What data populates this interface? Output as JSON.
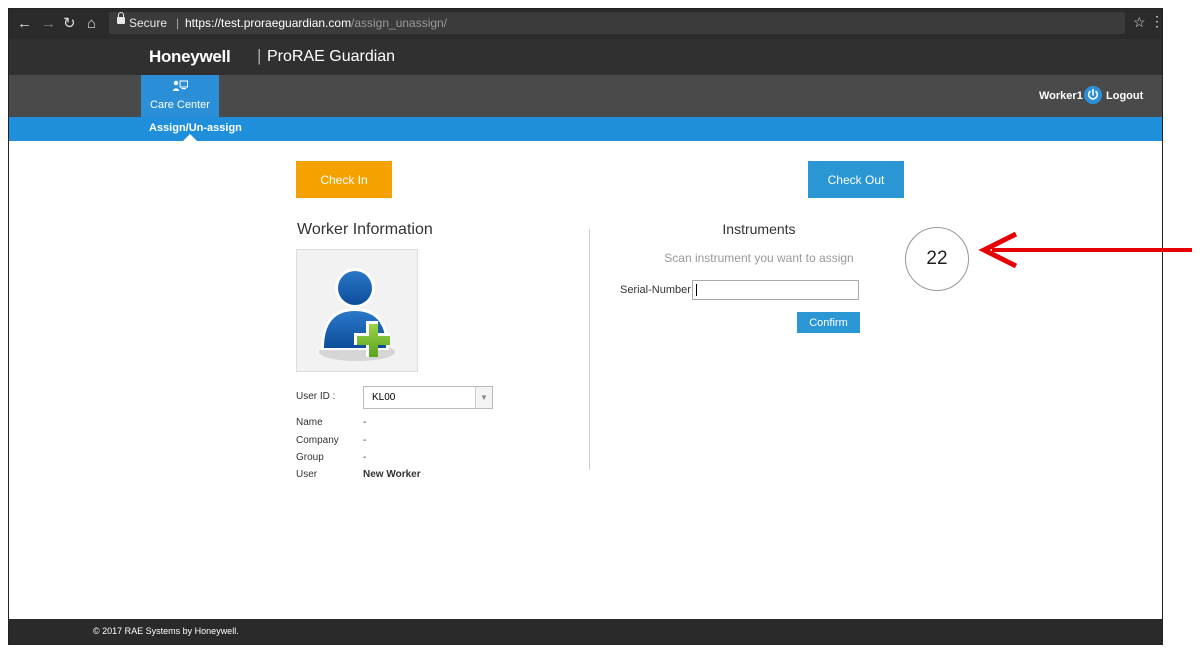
{
  "browser": {
    "secure_label": "Secure",
    "separator": "|",
    "url_host": "https://test.proraeguardian.com",
    "url_path": "/assign_unassign/"
  },
  "header": {
    "brand": "Honeywell",
    "brand_separator": "|",
    "product": "ProRAE Guardian"
  },
  "nav": {
    "care_center_label": "Care Center",
    "user": "Worker1",
    "logout_label": "Logout",
    "subnav_item": "Assign/Un-assign"
  },
  "actions": {
    "check_in_label": "Check In",
    "check_out_label": "Check Out"
  },
  "worker": {
    "title": "Worker Information",
    "user_id_label": "User ID :",
    "user_id_value": "KL00",
    "name_label": "Name",
    "name_value": "-",
    "company_label": "Company",
    "company_value": "-",
    "group_label": "Group",
    "group_value": "-",
    "user_label": "User",
    "user_value": "New Worker"
  },
  "instruments": {
    "title": "Instruments",
    "subtitle": "Scan instrument you want to assign",
    "serial_label": "Serial-Number :",
    "serial_value": "",
    "confirm_label": "Confirm"
  },
  "annotation": {
    "number": "22",
    "arrow_color": "#e60000"
  },
  "footer": {
    "copyright": "© 2017 RAE Systems by Honeywell."
  },
  "colors": {
    "brand_blue": "#1f8fdb",
    "check_in_orange": "#f5a200",
    "button_blue": "#2a97d4"
  }
}
